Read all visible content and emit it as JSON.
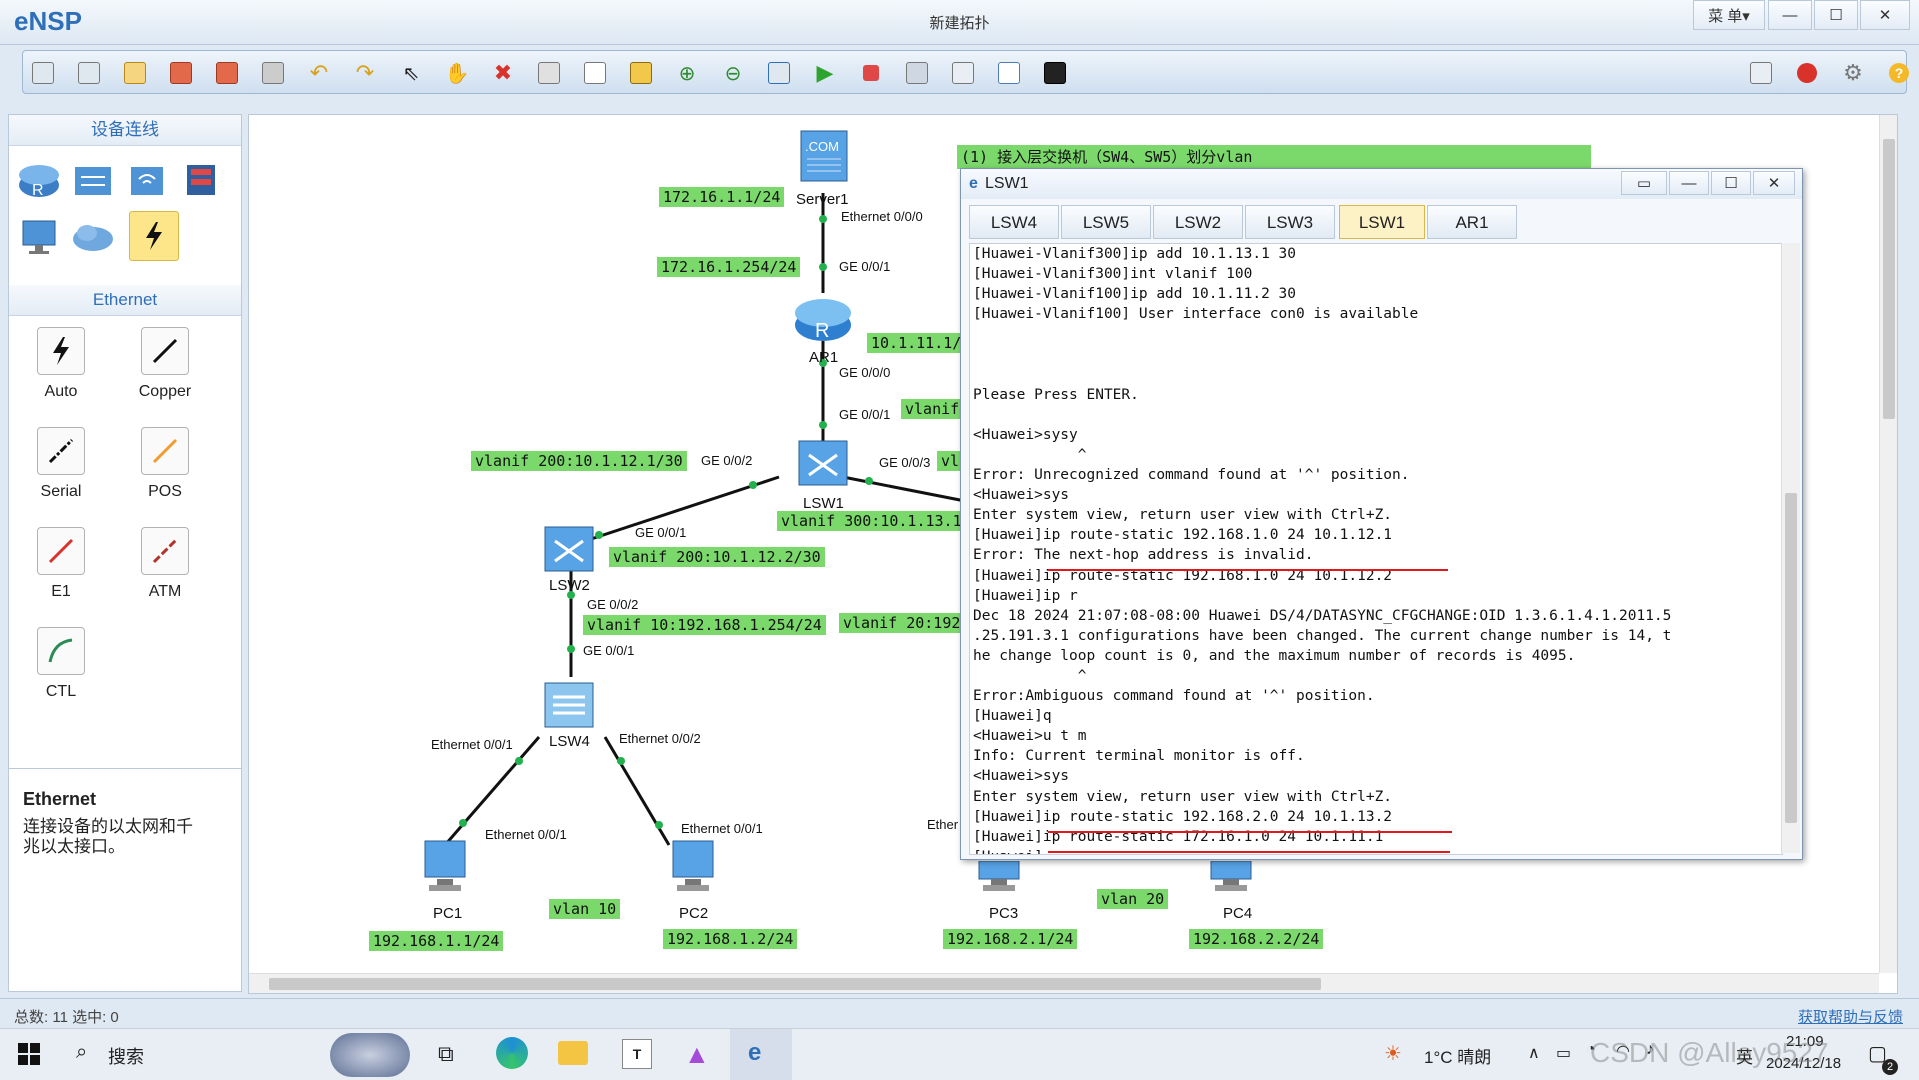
{
  "app": {
    "logo": "eNSP",
    "window_title": "新建拓扑",
    "menu_label": "菜 单▾"
  },
  "window_controls": {
    "minimize": "—",
    "maximize": "☐",
    "close": "✕"
  },
  "left_panel": {
    "devices_title": "设备连线",
    "category_title": "Ethernet",
    "cables": [
      {
        "label": "Auto",
        "color": "#111111"
      },
      {
        "label": "Copper",
        "color": "#111111"
      },
      {
        "label": "Serial",
        "color": "#111111"
      },
      {
        "label": "POS",
        "color": "#f39b2e"
      },
      {
        "label": "E1",
        "color": "#d8322b"
      },
      {
        "label": "ATM",
        "color": "#b2342a"
      },
      {
        "label": "CTL",
        "color": "#2e8b57"
      }
    ],
    "info_title": "Ethernet",
    "info_desc_line1": "连接设备的以太网和千",
    "info_desc_line2": "兆以太接口。"
  },
  "topology": {
    "nodes": {
      "server1": "Server1",
      "ar1": "AR1",
      "lsw1": "LSW1",
      "lsw2": "LSW2",
      "lsw4": "LSW4",
      "pc1": "PC1",
      "pc2": "PC2",
      "pc3": "PC3",
      "pc4": "PC4"
    },
    "green_labels": {
      "server_ip": "172.16.1.1/24",
      "ar1_up_ip": "172.16.1.254/24",
      "ar1_down_ip": "10.1.11.1/",
      "vlanif_partial": "vlanif",
      "vlanif200_lsw1": "vlanif 200:10.1.12.1/30",
      "vlanif300_lsw1": "vlanif 300:10.1.13.1",
      "vlanif200_lsw2": "vlanif 200:10.1.12.2/30",
      "vlanif10_lsw2": "vlanif 10:192.168.1.254/24",
      "vlanif20_partial": "vlanif 20:192",
      "vl_partial": "vl",
      "vlan10": "vlan 10",
      "vlan20": "vlan 20",
      "pc1_ip": "192.168.1.1/24",
      "pc2_ip": "192.168.1.2/24",
      "pc3_ip": "192.168.2.1/24",
      "pc4_ip": "192.168.2.2/24",
      "note": "(1) 接入层交换机（SW4、SW5）划分vlan"
    },
    "ports": {
      "server_eth": "Ethernet 0/0/0",
      "ar1_ge001": "GE 0/0/1",
      "ar1_ge000": "GE 0/0/0",
      "lsw1_ge001": "GE 0/0/1",
      "lsw1_ge002": "GE 0/0/2",
      "lsw1_ge003": "GE 0/0/3",
      "lsw2_ge001": "GE 0/0/1",
      "lsw2_ge002": "GE 0/0/2",
      "lsw4_ge001": "GE 0/0/1",
      "lsw4_eth001": "Ethernet 0/0/1",
      "lsw4_eth002": "Ethernet 0/0/2",
      "pc1_eth": "Ethernet 0/0/1",
      "pc2_eth": "Ethernet 0/0/1",
      "pc3_partial": "Ether"
    }
  },
  "console": {
    "title": "LSW1",
    "tabs": [
      "LSW4",
      "LSW5",
      "LSW2",
      "LSW3",
      "LSW1",
      "AR1"
    ],
    "active_tab": "LSW1",
    "lines": [
      "[Huawei-Vlanif300]ip add 10.1.13.1 30",
      "[Huawei-Vlanif300]int vlanif 100",
      "[Huawei-Vlanif100]ip add 10.1.11.2 30",
      "[Huawei-Vlanif100] User interface con0 is available",
      "",
      "",
      "",
      "Please Press ENTER.",
      "",
      "<Huawei>sysy",
      "            ^",
      "Error: Unrecognized command found at '^' position.",
      "<Huawei>sys",
      "Enter system view, return user view with Ctrl+Z.",
      "[Huawei]ip route-static 192.168.1.0 24 10.1.12.1",
      "Error: The next-hop address is invalid.",
      "[Huawei]ip route-static 192.168.1.0 24 10.1.12.2",
      "[Huawei]ip r",
      "Dec 18 2024 21:07:08-08:00 Huawei DS/4/DATASYNC_CFGCHANGE:OID 1.3.6.1.4.1.2011.5",
      ".25.191.3.1 configurations have been changed. The current change number is 14, t",
      "he change loop count is 0, and the maximum number of records is 4095.",
      "            ^",
      "Error:Ambiguous command found at '^' position.",
      "[Huawei]q",
      "<Huawei>u t m",
      "Info: Current terminal monitor is off.",
      "<Huawei>sys",
      "Enter system view, return user view with Ctrl+Z.",
      "[Huawei]ip route-static 192.168.2.0 24 10.1.13.2",
      "[Huawei]ip route-static 172.16.1.0 24 10.1.11.1",
      "[Huawei]"
    ]
  },
  "status": {
    "left": "总数: 11 选中: 0",
    "right": "获取帮助与反馈"
  },
  "taskbar": {
    "search": "搜索",
    "weather": "1°C 晴朗",
    "time": "21:09",
    "date": "2024/12/18",
    "ime": "英",
    "watermark": "CSDN @Alley9527",
    "notify_count": "2"
  }
}
